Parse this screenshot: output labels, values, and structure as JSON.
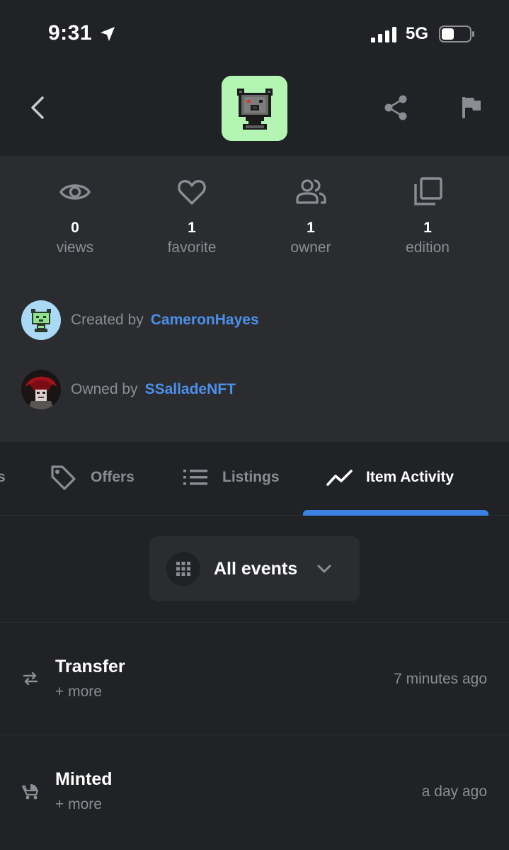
{
  "status_bar": {
    "time": "9:31",
    "network": "5G"
  },
  "stats": [
    {
      "count": "0",
      "label": "views",
      "icon": "eye-icon"
    },
    {
      "count": "1",
      "label": "favorite",
      "icon": "heart-icon"
    },
    {
      "count": "1",
      "label": "owner",
      "icon": "people-icon"
    },
    {
      "count": "1",
      "label": "edition",
      "icon": "copies-icon"
    }
  ],
  "creator": {
    "prefix": "Created by",
    "name": "CameronHayes"
  },
  "owner": {
    "prefix": "Owned by",
    "name": "SSalladeNFT"
  },
  "tabs": [
    {
      "label": "s"
    },
    {
      "label": "Offers",
      "icon": "tag-icon"
    },
    {
      "label": "Listings",
      "icon": "list-icon"
    },
    {
      "label": "Item Activity",
      "icon": "trending-icon",
      "active": true
    }
  ],
  "filter": {
    "label": "All events"
  },
  "activity": [
    {
      "title": "Transfer",
      "more": "+ more",
      "time": "7 minutes ago",
      "icon": "transfer-arrows-icon"
    },
    {
      "title": "Minted",
      "more": "+ more",
      "time": "a day ago",
      "icon": "stroller-icon"
    }
  ],
  "colors": {
    "accent": "#3b82e0",
    "link": "#4c8fe8",
    "background": "#202225",
    "panel": "#2a2c30",
    "avatar_bg": "#b4f5b4"
  }
}
